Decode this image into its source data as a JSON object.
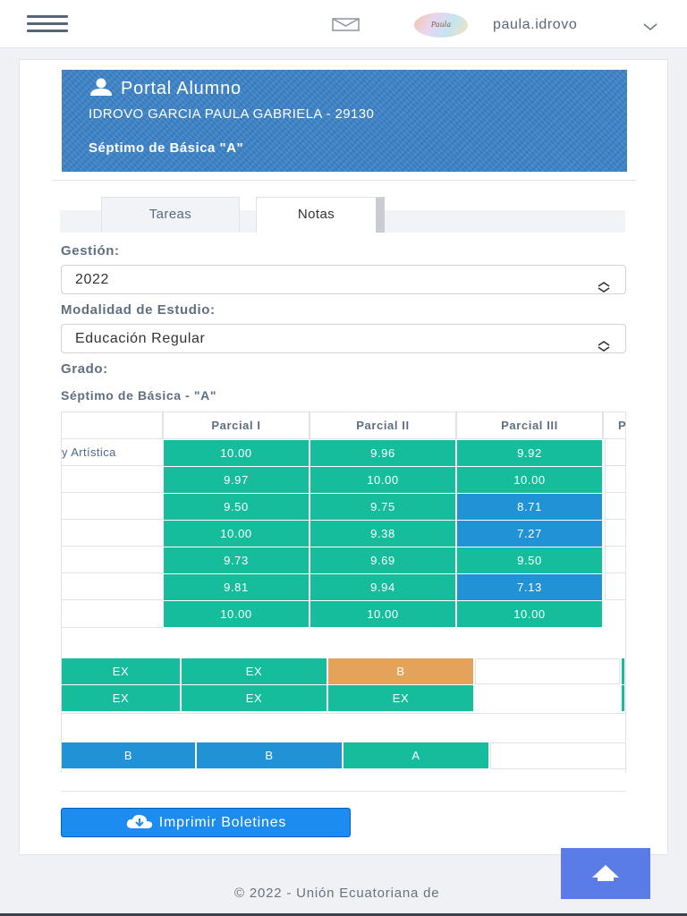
{
  "header": {
    "menu_icon": "hamburger-icon",
    "mail_icon": "envelope-icon",
    "avatar_text": "Paula",
    "username": "paula.idrovo",
    "dropdown_icon": "chevron-down-icon"
  },
  "banner": {
    "title": "Portal Alumno",
    "title_icon": "user-icon",
    "student_name": "IDROVO GARCIA PAULA GABRIELA - 29130",
    "grade": "Séptimo de Básica \"A\""
  },
  "tabs": [
    {
      "label": "Tareas",
      "active": false
    },
    {
      "label": "Notas",
      "active": true
    }
  ],
  "filters": {
    "gestion_label": "Gestión:",
    "gestion_value": "2022",
    "modalidad_label": "Modalidad de Estudio:",
    "modalidad_value": "Educación Regular",
    "grado_label": "Grado:",
    "grado_value": "Séptimo de Básica - \"A\""
  },
  "grades_table": {
    "columns": [
      "Parcial I",
      "Parcial II",
      "Parcial III",
      "P"
    ],
    "rows": [
      {
        "subject": "y Artística",
        "values": [
          "10.00",
          "9.96",
          "9.92"
        ],
        "status": [
          "green",
          "green",
          "green"
        ]
      },
      {
        "subject": "",
        "values": [
          "9.97",
          "10.00",
          "10.00"
        ],
        "status": [
          "green",
          "green",
          "green"
        ]
      },
      {
        "subject": "",
        "values": [
          "9.50",
          "9.75",
          "8.71"
        ],
        "status": [
          "green",
          "green",
          "blue"
        ]
      },
      {
        "subject": "",
        "values": [
          "10.00",
          "9.38",
          "7.27"
        ],
        "status": [
          "green",
          "green",
          "blue"
        ]
      },
      {
        "subject": "",
        "values": [
          "9.73",
          "9.69",
          "9.50"
        ],
        "status": [
          "green",
          "green",
          "green"
        ]
      },
      {
        "subject": "",
        "values": [
          "9.81",
          "9.94",
          "7.13"
        ],
        "status": [
          "green",
          "green",
          "blue"
        ]
      },
      {
        "subject": "",
        "values": [
          "10.00",
          "10.00",
          "10.00"
        ],
        "status": [
          "green",
          "green",
          "green"
        ]
      }
    ]
  },
  "conduct_table": {
    "rows": [
      {
        "values": [
          "EX",
          "EX",
          "B",
          ""
        ],
        "status": [
          "green",
          "green",
          "orange",
          "empty"
        ]
      },
      {
        "values": [
          "EX",
          "EX",
          "EX",
          ""
        ],
        "status": [
          "green",
          "green",
          "green",
          "empty"
        ]
      }
    ]
  },
  "summary_table": {
    "rows": [
      {
        "values": [
          "B",
          "B",
          "A",
          ""
        ],
        "status": [
          "blue",
          "blue",
          "green",
          "empty"
        ]
      }
    ]
  },
  "actions": {
    "print_label": "Imprimir Boletines",
    "print_icon": "cloud-download-icon"
  },
  "footer": {
    "text": "© 2022 - Unión Ecuatoriana de",
    "scroll_top_icon": "arrow-up-icon"
  },
  "colors": {
    "green": "#16bd9d",
    "blue": "#2192d6",
    "orange": "#e3a35a",
    "banner": "#3b82c8",
    "primary_button": "#1d8cf0"
  }
}
